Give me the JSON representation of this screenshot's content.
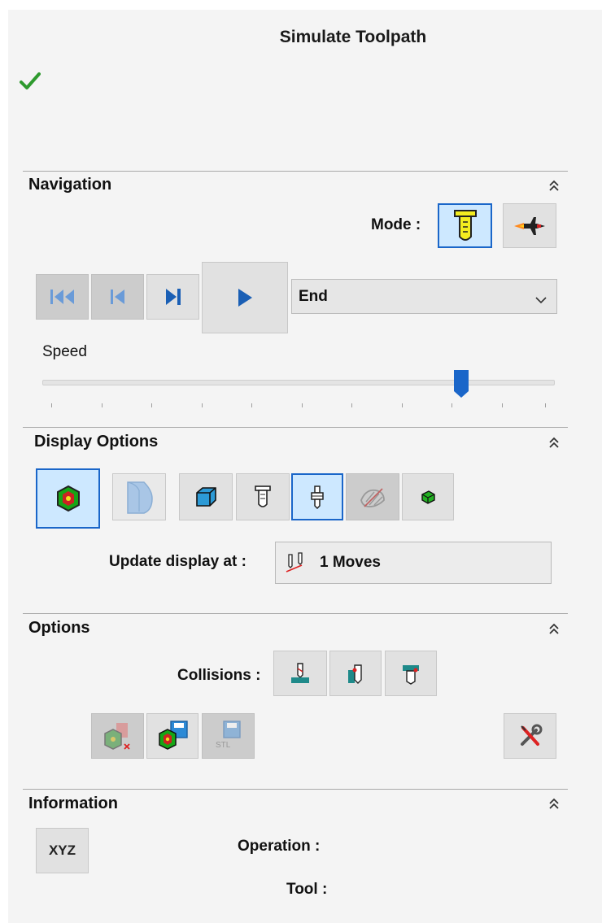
{
  "window": {
    "title": "Simulate Toolpath"
  },
  "navigation": {
    "header": "Navigation",
    "mode_label": "Mode :",
    "step_mode_selected": "End",
    "speed_label": "Speed",
    "speed_fraction": 0.81
  },
  "display_options": {
    "header": "Display Options",
    "update_label": "Update display at :",
    "update_value": "1 Moves"
  },
  "options": {
    "header": "Options",
    "collisions_label": "Collisions :"
  },
  "information": {
    "header": "Information",
    "xyz_label": "XYZ",
    "operation_label": "Operation :",
    "tool_label": "Tool :"
  },
  "colors": {
    "accent": "#1a66c9",
    "check": "#2e9a2e",
    "selected_bg": "#cde8ff"
  }
}
